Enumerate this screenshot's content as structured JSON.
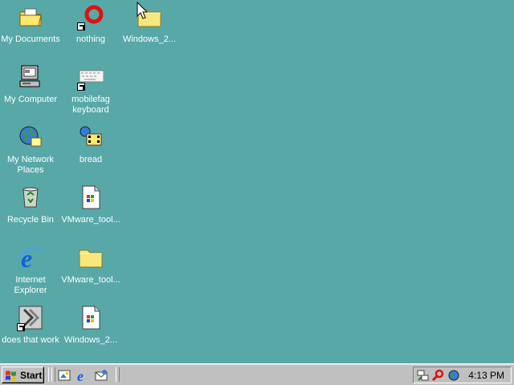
{
  "desktop": {
    "background": "#58a8a8",
    "icons": [
      {
        "label": "My Documents",
        "icon": "my-documents-icon"
      },
      {
        "label": "nothing",
        "icon": "red-ring-icon"
      },
      {
        "label": "Windows_2...",
        "icon": "folder-icon"
      },
      {
        "label": "My Computer",
        "icon": "my-computer-icon"
      },
      {
        "label": "mobilefag\nkeyboard",
        "icon": "keyboard-icon"
      },
      {
        "label": "My Network\nPlaces",
        "icon": "network-places-icon"
      },
      {
        "label": "bread",
        "icon": "media-file-icon"
      },
      {
        "label": "Recycle Bin",
        "icon": "recycle-bin-icon"
      },
      {
        "label": "VMware_tool...",
        "icon": "installer-file-icon"
      },
      {
        "label": "Internet\nExplorer",
        "icon": "internet-explorer-icon"
      },
      {
        "label": "VMware_tool...",
        "icon": "folder-icon"
      },
      {
        "label": "does that work",
        "icon": "shortcut-app-icon"
      },
      {
        "label": "Windows_2...",
        "icon": "installer-file-icon"
      }
    ]
  },
  "taskbar": {
    "start_label": "Start",
    "quick_launch": [
      "show-desktop-icon",
      "internet-explorer-icon",
      "outlook-express-icon"
    ],
    "tray_icons": [
      "network-icon",
      "search-icon",
      "media-icon"
    ],
    "clock": "4:13 PM"
  }
}
